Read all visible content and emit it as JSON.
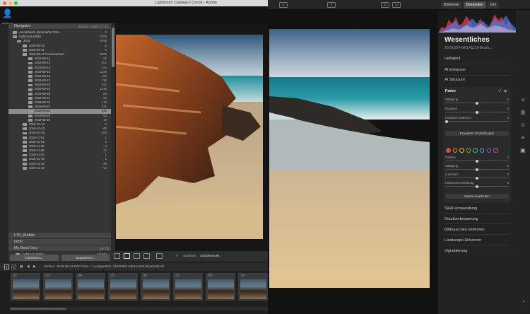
{
  "lightroom": {
    "window_title": "Lightroom Catalog-2-3.lrcat - Adobe",
    "logo_caption": "Lightroom",
    "navigator_label": "Navigator",
    "navigator_opts": "Einpas.   Ausfü  1:1  3:1",
    "folders": [
      {
        "name": "Automatisch importierte Fotos",
        "count": "0",
        "level": 1,
        "selected": false
      },
      {
        "name": "Lightroom Bilder",
        "count": "6766",
        "level": 1,
        "selected": false
      },
      {
        "name": "2019",
        "count": "6766",
        "level": 2,
        "selected": false
      },
      {
        "name": "2019-09-10",
        "count": "6",
        "level": 3,
        "selected": false
      },
      {
        "name": "2019-09-11",
        "count": "5",
        "level": 3,
        "selected": false
      },
      {
        "name": "2019-09-12 Fuerteventura",
        "count": "5369",
        "level": 3,
        "selected": false
      },
      {
        "name": "2019-09-12",
        "count": "80",
        "level": 4,
        "selected": false
      },
      {
        "name": "2019-09-13",
        "count": "201",
        "level": 4,
        "selected": false
      },
      {
        "name": "2019-09-14",
        "count": "143",
        "level": 4,
        "selected": false
      },
      {
        "name": "2019-09-15",
        "count": "1049",
        "level": 4,
        "selected": false
      },
      {
        "name": "2019-09-16",
        "count": "422",
        "level": 4,
        "selected": false
      },
      {
        "name": "2019-09-17",
        "count": "136",
        "level": 4,
        "selected": false
      },
      {
        "name": "2019-09-18",
        "count": "441",
        "level": 4,
        "selected": false
      },
      {
        "name": "2019-09-19",
        "count": "1246",
        "level": 4,
        "selected": false
      },
      {
        "name": "2019-09-20",
        "count": "84",
        "level": 4,
        "selected": false
      },
      {
        "name": "2019-09-21",
        "count": "81",
        "level": 4,
        "selected": false
      },
      {
        "name": "2019-09-22",
        "count": "179",
        "level": 4,
        "selected": false
      },
      {
        "name": "2019-09-23",
        "count": "341",
        "level": 4,
        "selected": false
      },
      {
        "name": "2019-09-24",
        "count": "620",
        "level": 4,
        "selected": true
      },
      {
        "name": "2019-09-25",
        "count": "63",
        "level": 4,
        "selected": false
      },
      {
        "name": "2019-09-26",
        "count": "18",
        "level": 4,
        "selected": false
      },
      {
        "name": "2019-10-12",
        "count": "2",
        "level": 3,
        "selected": false
      },
      {
        "name": "2019-10-15",
        "count": "65",
        "level": 3,
        "selected": false
      },
      {
        "name": "2019-10-25",
        "count": "393",
        "level": 3,
        "selected": false
      },
      {
        "name": "2019-11-02",
        "count": "1",
        "level": 3,
        "selected": false
      },
      {
        "name": "2019-11-03",
        "count": "3",
        "level": 3,
        "selected": false
      },
      {
        "name": "2019-11-08",
        "count": "2",
        "level": 3,
        "selected": false
      },
      {
        "name": "2019-11-09",
        "count": "71",
        "level": 3,
        "selected": false
      },
      {
        "name": "2019-11-10",
        "count": "1",
        "level": 3,
        "selected": false
      },
      {
        "name": "2019-11-15",
        "count": "1",
        "level": 3,
        "selected": false
      },
      {
        "name": "2019-11-18",
        "count": "99",
        "level": 3,
        "selected": false
      },
      {
        "name": "2019-11-19",
        "count": "712",
        "level": 3,
        "selected": false
      }
    ],
    "lower_panels": [
      {
        "label": "LTR_Mobile",
        "count": ""
      },
      {
        "label": "Orbit",
        "count": ""
      },
      {
        "label": "My Book Duo",
        "count": "2/6 TB"
      },
      {
        "label": "Lightroom Bilder",
        "count": "141966"
      },
      {
        "label": "2011",
        "count": ""
      }
    ],
    "import_label": "Importieren...",
    "export_label": "Exportieren...",
    "toolbar_sort_label": "Sortieren:",
    "toolbar_sort_value": "Aufnahmezeit",
    "film_bar_text": "Ordner : 2019-09-24   620 Fotos / 1 ausgewählt /  20190924-MK1A1129-Bearbeitet.tif",
    "film_page_1": "1",
    "film_page_2": "2",
    "film_numbers": [
      "32",
      "33",
      "34",
      "35",
      "36",
      "37",
      "38",
      "39"
    ]
  },
  "luminar": {
    "tabs": [
      {
        "label": "Bibliothek",
        "active": false
      },
      {
        "label": "Bearbeiten",
        "active": true
      },
      {
        "label": "Info",
        "active": false
      }
    ],
    "title": "Wesentliches",
    "subtitle": "20190924-MK1A1129-Bearb...",
    "sections_top": [
      "Helligkeit",
      "AI Enhancer",
      "AI Structure"
    ],
    "farbe": {
      "title": "Farbe",
      "sliders": [
        {
          "label": "Sättigung",
          "value": "0",
          "pos": 0.5
        },
        {
          "label": "Dynamik",
          "value": "0",
          "pos": 0.5
        },
        {
          "label": "Farbstich entfernen",
          "value": "0",
          "pos": 0.0
        }
      ],
      "advanced_label": "Erweiterte Einstellungen",
      "swatch_colors": [
        "#d24a3a",
        "#e08a3a",
        "#e0c23a",
        "#6cbf3a",
        "#3abf8a",
        "#3aa6d8",
        "#6a62d8",
        "#c84cc0"
      ],
      "sliders2": [
        {
          "label": "Farbton",
          "value": "0",
          "pos": 0.5
        },
        {
          "label": "Sättigung",
          "value": "0",
          "pos": 0.5
        },
        {
          "label": "Luminanz",
          "value": "0",
          "pos": 0.5
        },
        {
          "label": "Farbtonverschiebung",
          "value": "0",
          "pos": 0.5
        }
      ],
      "mask_label": "Maske bearbeiten"
    },
    "sections_bottom": [
      "S&W-Umwandlung",
      "Detailverbesserung",
      "Bildrauschen entfernen",
      "Landscape Enhancer",
      "Vignettierung"
    ],
    "colors": {
      "accent": "#e6e6e6",
      "histogram_red": "#e23a52",
      "histogram_blue": "#4a7adf"
    }
  }
}
